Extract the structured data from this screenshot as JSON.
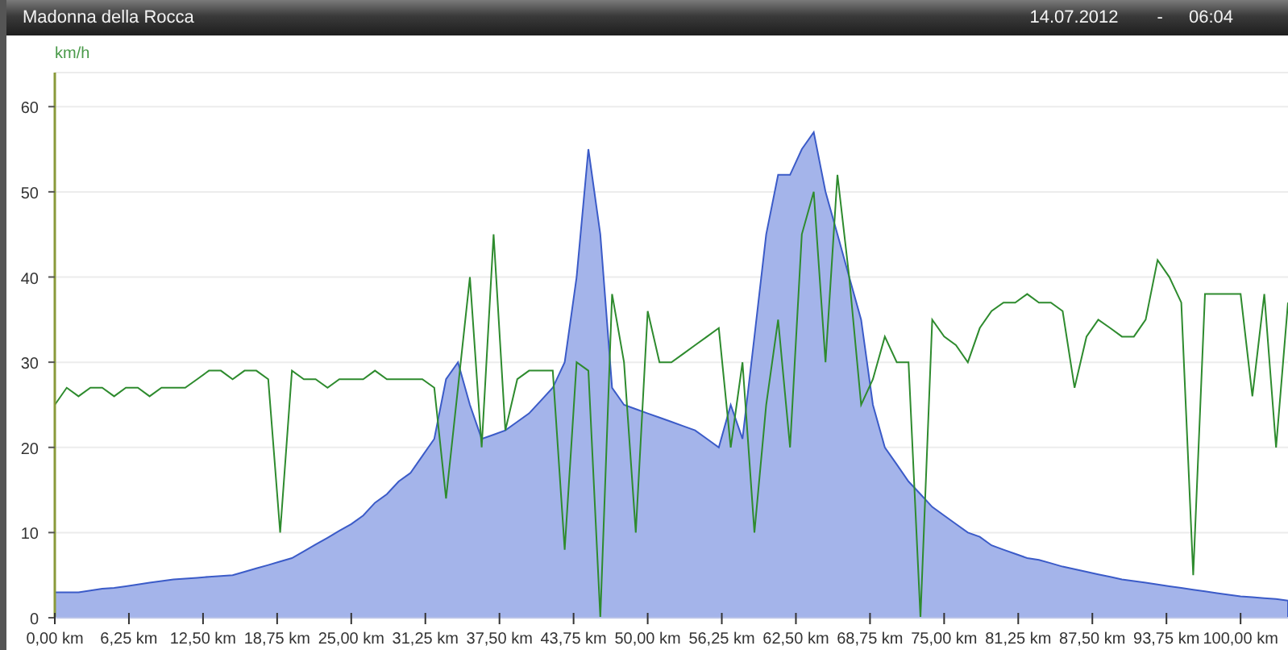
{
  "header": {
    "title": "Madonna della Rocca",
    "date": "14.07.2012",
    "separator": "-",
    "time": "06:04"
  },
  "chart": {
    "chart_data": {
      "type": "line",
      "grid": true,
      "ylabel": "km/h",
      "xlim": [
        0,
        104
      ],
      "ylim": [
        0,
        64
      ],
      "yticks": [
        0,
        10,
        20,
        30,
        40,
        50,
        60
      ],
      "xticks": [
        {
          "value": 0,
          "label": "0,00 km"
        },
        {
          "value": 6.25,
          "label": "6,25 km"
        },
        {
          "value": 12.5,
          "label": "12,50 km"
        },
        {
          "value": 18.75,
          "label": "18,75 km"
        },
        {
          "value": 25,
          "label": "25,00 km"
        },
        {
          "value": 31.25,
          "label": "31,25 km"
        },
        {
          "value": 37.5,
          "label": "37,50 km"
        },
        {
          "value": 43.75,
          "label": "43,75 km"
        },
        {
          "value": 50,
          "label": "50,00 km"
        },
        {
          "value": 56.25,
          "label": "56,25 km"
        },
        {
          "value": 62.5,
          "label": "62,50 km"
        },
        {
          "value": 68.75,
          "label": "68,75 km"
        },
        {
          "value": 75,
          "label": "75,00 km"
        },
        {
          "value": 81.25,
          "label": "81,25 km"
        },
        {
          "value": 87.5,
          "label": "87,50 km"
        },
        {
          "value": 93.75,
          "label": "93,75 km"
        },
        {
          "value": 100,
          "label": "100,00 km"
        }
      ],
      "x": [
        0,
        1,
        2,
        3,
        4,
        5,
        6,
        7,
        8,
        9,
        10,
        11,
        12,
        13,
        14,
        15,
        16,
        17,
        18,
        19,
        20,
        21,
        22,
        23,
        24,
        25,
        26,
        27,
        28,
        29,
        30,
        31,
        32,
        33,
        34,
        35,
        36,
        37,
        38,
        39,
        40,
        41,
        42,
        43,
        44,
        45,
        46,
        47,
        48,
        49,
        50,
        51,
        52,
        53,
        54,
        55,
        56,
        57,
        58,
        59,
        60,
        61,
        62,
        63,
        64,
        65,
        66,
        67,
        68,
        69,
        70,
        71,
        72,
        73,
        74,
        75,
        76,
        77,
        78,
        79,
        80,
        81,
        82,
        83,
        84,
        85,
        86,
        87,
        88,
        89,
        90,
        91,
        92,
        93,
        94,
        95,
        96,
        97,
        98,
        99,
        100,
        101,
        102,
        103,
        104
      ],
      "series": [
        {
          "type": "area",
          "color": "#a4b4ea",
          "values": [
            3,
            3,
            3,
            3.2,
            3.4,
            3.5,
            3.7,
            3.9,
            4.1,
            4.3,
            4.5,
            4.6,
            4.7,
            4.8,
            4.9,
            5,
            5.4,
            5.8,
            6.2,
            6.6,
            7,
            7.8,
            8.6,
            9.4,
            10.2,
            11,
            12,
            13.5,
            14.5,
            16,
            17,
            19,
            21,
            28,
            30,
            25,
            21,
            21.5,
            22,
            23,
            24,
            25.5,
            27,
            30,
            40,
            55,
            45,
            27,
            25,
            24.5,
            24,
            23.5,
            23,
            22.5,
            22,
            21,
            20,
            25,
            21,
            33,
            45,
            52,
            52,
            55,
            57,
            50,
            45,
            40,
            35,
            25,
            20,
            18,
            16,
            14.5,
            13,
            12,
            11,
            10,
            9.5,
            8.5,
            8,
            7.5,
            7,
            6.8,
            6.4,
            6,
            5.7,
            5.4,
            5.1,
            4.8,
            4.5,
            4.3,
            4.1,
            3.9,
            3.7,
            3.5,
            3.3,
            3.1,
            2.9,
            2.7,
            2.5,
            2.4,
            2.3,
            2.2,
            2
          ]
        },
        {
          "color": "#2e8b2e",
          "values": [
            25,
            27,
            26,
            27,
            27,
            26,
            27,
            27,
            26,
            27,
            27,
            27,
            28,
            29,
            29,
            28,
            29,
            29,
            28,
            10,
            29,
            28,
            28,
            27,
            28,
            28,
            28,
            29,
            28,
            28,
            28,
            28,
            27,
            14,
            27,
            40,
            20,
            45,
            22,
            28,
            29,
            29,
            29,
            8,
            30,
            29,
            0,
            38,
            30,
            10,
            36,
            30,
            30,
            31,
            32,
            33,
            34,
            20,
            30,
            10,
            25,
            35,
            20,
            45,
            50,
            30,
            52,
            40,
            25,
            28,
            33,
            30,
            30,
            0,
            35,
            33,
            32,
            30,
            34,
            36,
            37,
            37,
            38,
            37,
            37,
            36,
            27,
            33,
            35,
            34,
            33,
            33,
            35,
            42,
            40,
            37,
            5,
            38,
            38,
            38,
            38,
            26,
            38,
            20,
            37
          ]
        }
      ]
    }
  }
}
